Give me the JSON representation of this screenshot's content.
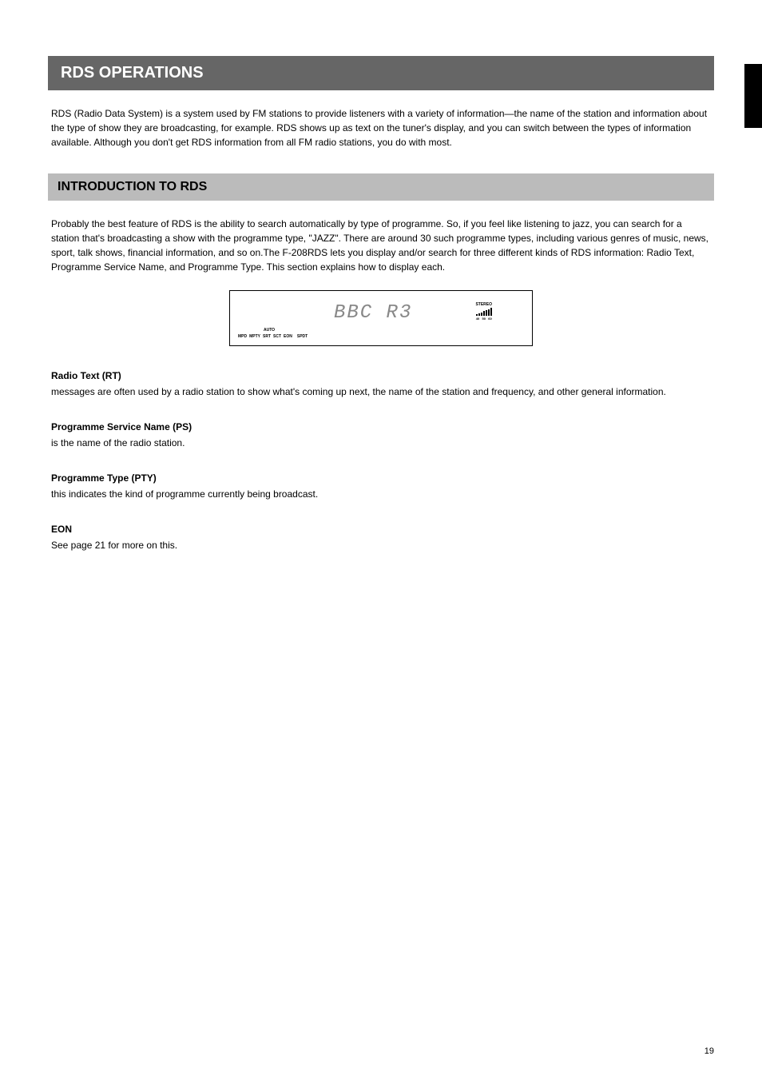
{
  "header": {
    "title": "RDS OPERATIONS"
  },
  "intro": "RDS (Radio Data System) is a system used by FM stations to provide listeners with a variety of information—the name of the station and information about the type of show they are broadcasting, for example. RDS shows up as text on the tuner's display, and you can switch between the types of information available. Although you don't get RDS information from all FM radio stations, you do with most.",
  "section": {
    "title": "INTRODUCTION TO RDS"
  },
  "sectionDesc": "Probably the best feature of RDS is the ability to search automatically by type of programme. So, if you feel like listening to jazz, you can search for a station that's broadcasting a show with the programme type, \"JAZZ\". There are around 30 such programme types, including various genres of music, news, sport, talk shows, financial information, and so on.The F-208RDS lets you display and/or search for three different kinds of RDS information: Radio Text, Programme Service Name, and Programme Type. This section explains how to display each.",
  "lcd": {
    "mainText": "BBC R3",
    "auto": "AUTO",
    "indicators": [
      "MPD",
      "MPTY",
      "SRT",
      "SCT",
      "EON",
      "",
      "SPDT"
    ],
    "stereo": "STEREO",
    "signalLabels": [
      "40",
      "50",
      "60"
    ]
  },
  "features": [
    {
      "title": "Radio Text (RT)",
      "desc": "messages are often used by a radio station to show what's coming up next, the name of the station and frequency, and other general information."
    },
    {
      "title": "Programme Service Name (PS)",
      "desc": "is the name of the radio station."
    },
    {
      "title": "Programme Type (PTY)",
      "desc": "this indicates the kind of programme currently being broadcast."
    },
    {
      "title": "EON",
      "desc": "See page 21 for more on this."
    }
  ],
  "pageNumber": "19"
}
